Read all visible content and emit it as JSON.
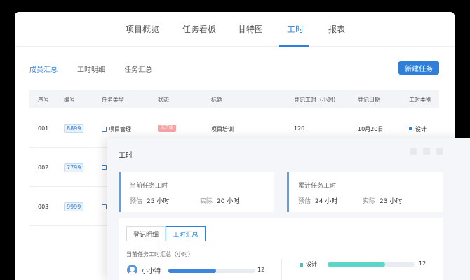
{
  "nav": {
    "tabs": [
      "项目概览",
      "任务看板",
      "甘特图",
      "工时",
      "报表"
    ],
    "active_index": 3
  },
  "subtabs": [
    "成员汇总",
    "工时明细",
    "任务汇总"
  ],
  "new_task_button": "新建任务",
  "table": {
    "headers": [
      "序号",
      "编号",
      "任务类型",
      "状态",
      "标题",
      "登记工时（小时）",
      "登记日期",
      "工时类别"
    ],
    "rows": [
      {
        "seq": "001",
        "code": "8899",
        "type": "项目管理",
        "status": "未开始",
        "title": "项目培训",
        "hours": "120",
        "date": "10月20日",
        "category": "设计"
      },
      {
        "seq": "002",
        "code": "7799"
      },
      {
        "seq": "003",
        "code": "9999"
      }
    ]
  },
  "panel": {
    "title": "工时",
    "cards": [
      {
        "title": "当前任务工时",
        "est_label": "预估",
        "est_value": "25 小时",
        "act_label": "实际",
        "act_value": "20 小时"
      },
      {
        "title": "累计任务工时",
        "est_label": "预估",
        "est_value": "24 小时",
        "act_label": "实际",
        "act_value": "23 小时"
      }
    ],
    "segments": [
      "登记明细",
      "工时汇总"
    ],
    "active_segment": 1,
    "summary_title": "当前任务工时汇总（小时）",
    "members": [
      {
        "name": "小小特",
        "hours": "12",
        "fill": 0.55
      }
    ],
    "categories": [
      {
        "name": "设计",
        "hours": "12",
        "fill": 0.66
      }
    ],
    "colors": {
      "accent": "#2f7fd8",
      "member_bar": "#3d86dc",
      "category_bar": "#5cd6c6"
    }
  }
}
